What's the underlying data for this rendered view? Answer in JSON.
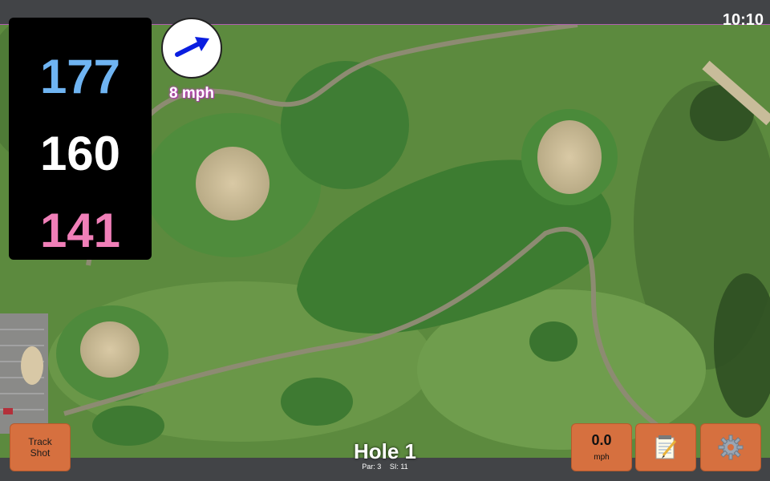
{
  "clock": "10:10",
  "distances": {
    "back": "177",
    "middle": "160",
    "front": "141"
  },
  "wind": {
    "speed": "8 mph",
    "icon": "wind-arrow-icon"
  },
  "buttons": {
    "track_shot_line1": "Track",
    "track_shot_line2": "Shot",
    "notes_icon": "notepad-icon",
    "settings_icon": "gear-icon"
  },
  "speed_display": {
    "value": "0.0",
    "unit": "mph"
  },
  "hole": {
    "title": "Hole 1",
    "par": "Par: 3",
    "stroke_index": "SI: 11"
  },
  "colors": {
    "back": "#6fb4f2",
    "middle": "#ffffff",
    "front": "#f07fb8",
    "button": "#d6703f",
    "bar": "#424447"
  }
}
